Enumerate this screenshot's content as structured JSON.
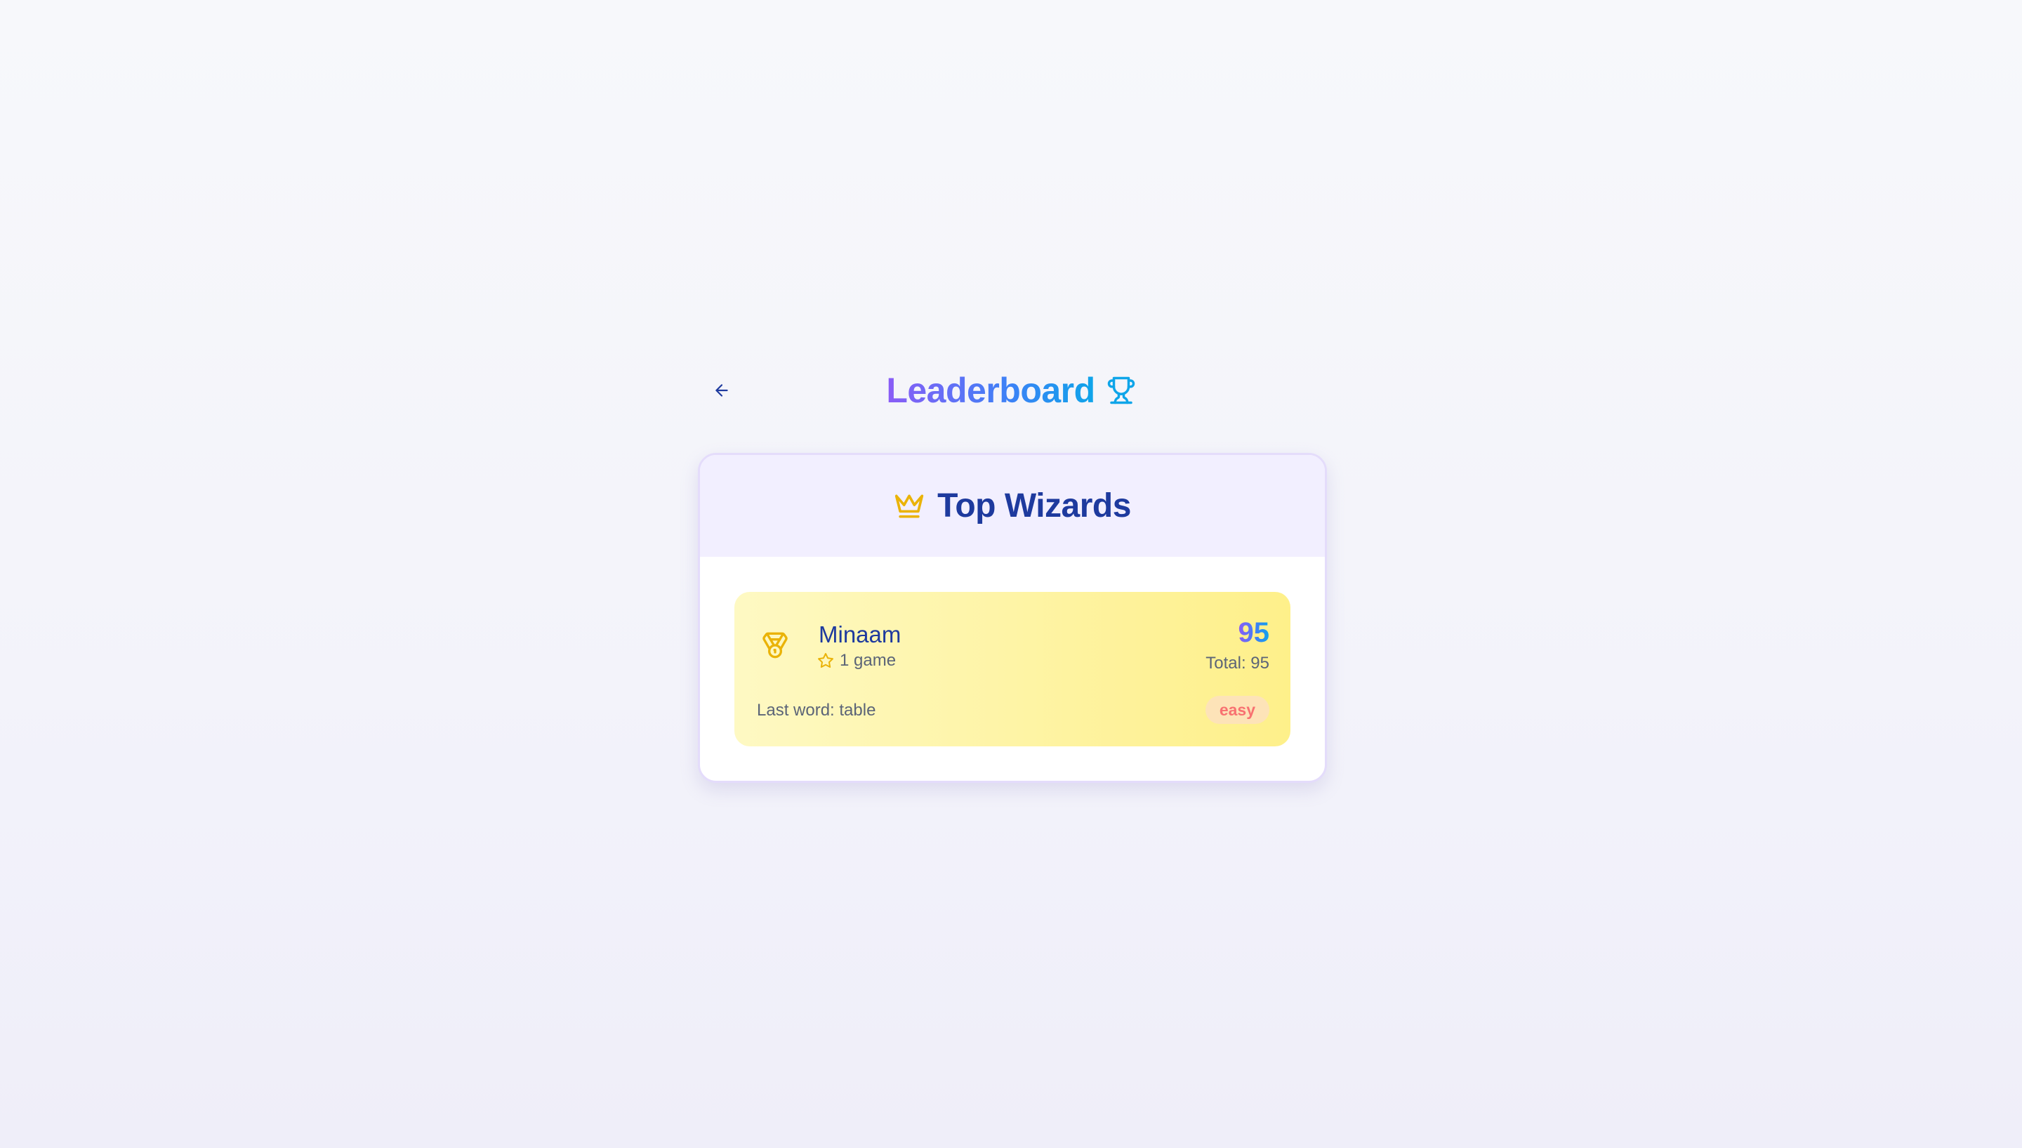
{
  "header": {
    "title": "Leaderboard",
    "back_icon": "arrow-left-icon",
    "title_icon": "trophy-icon"
  },
  "leaderboard": {
    "title": "Top Wizards",
    "title_icon": "crown-icon",
    "entries": [
      {
        "rank_icon": "medal-icon",
        "name": "Minaam",
        "games_icon": "star-icon",
        "games": "1 game",
        "score": "95",
        "total": "Total: 95",
        "last_word": "Last word: table",
        "difficulty": "easy"
      }
    ]
  },
  "colors": {
    "title_gradient_start": "#8b5cf6",
    "title_gradient_end": "#0ea5e9",
    "heading_blue": "#1e3a9e",
    "accent_gold": "#eab308",
    "entry_background": "#fef3a0",
    "card_header_background": "#f2efff",
    "badge_text": "#f87171"
  }
}
